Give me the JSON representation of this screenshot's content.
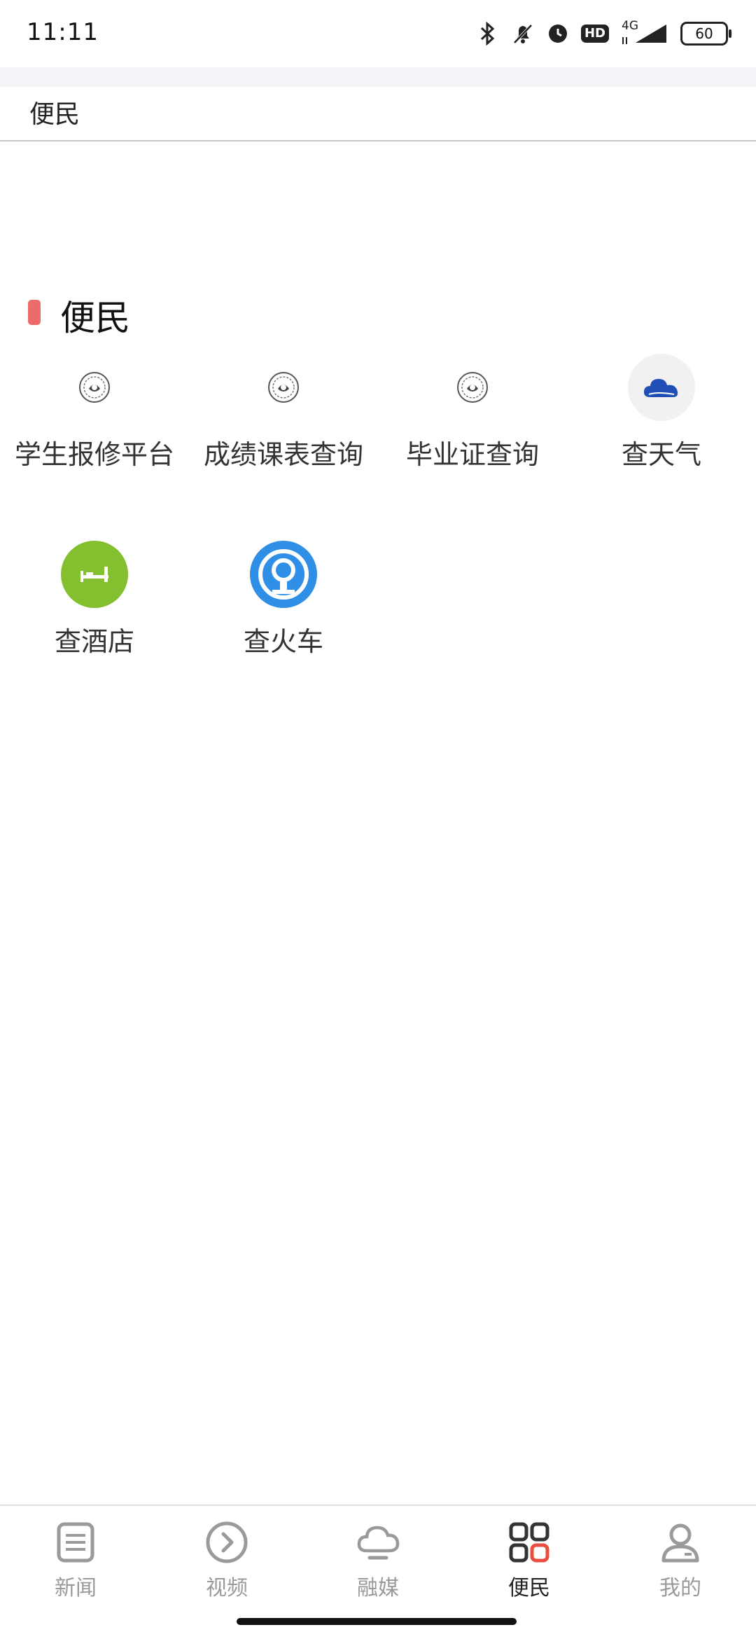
{
  "status_bar": {
    "time": "11:11",
    "hd": "HD",
    "network": "4G",
    "battery": "60"
  },
  "header": {
    "title": "便民"
  },
  "section": {
    "title": "便民",
    "marker_color": "#ee6b6b"
  },
  "services": [
    {
      "label": "学生报修平台",
      "icon": "school-emblem-icon"
    },
    {
      "label": "成绩课表查询",
      "icon": "school-emblem-icon"
    },
    {
      "label": "毕业证查询",
      "icon": "school-emblem-icon"
    },
    {
      "label": "查天气",
      "icon": "cloud-icon"
    },
    {
      "label": "查酒店",
      "icon": "bed-icon"
    },
    {
      "label": "查火车",
      "icon": "railway-icon"
    }
  ],
  "bottom_nav": [
    {
      "label": "新闻",
      "icon": "news-icon"
    },
    {
      "label": "视频",
      "icon": "video-icon"
    },
    {
      "label": "融媒",
      "icon": "cloud-media-icon"
    },
    {
      "label": "便民",
      "icon": "grid-icon",
      "active": true
    },
    {
      "label": "我的",
      "icon": "profile-icon"
    }
  ],
  "colors": {
    "accent": "#ee6b6b",
    "weather_icon": "#1f4fb5",
    "hotel_icon_bg": "#84bf2f",
    "train_icon": "#2f8fe6",
    "nav_active_red": "#e84d3d"
  }
}
